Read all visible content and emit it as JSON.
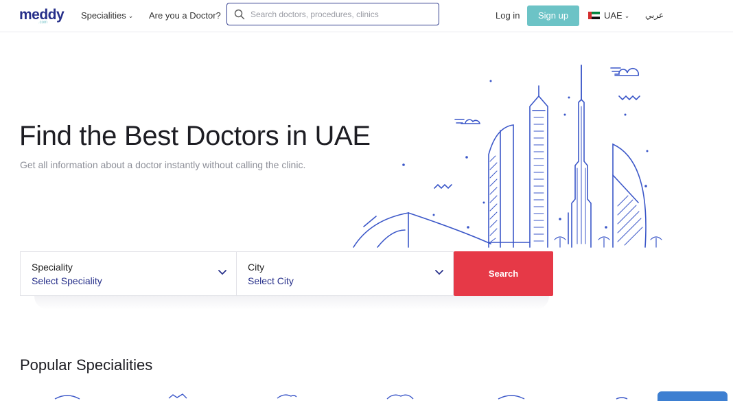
{
  "header": {
    "logo": "meddy",
    "logo_sub": ".com",
    "nav": {
      "specialities": "Specialities",
      "are_you_doctor": "Are you a Doctor?"
    },
    "search_placeholder": "Search doctors, procedures, clinics",
    "login": "Log in",
    "signup": "Sign up",
    "country": "UAE",
    "language": "عربي"
  },
  "hero": {
    "title": "Find the Best Doctors in UAE",
    "subtitle": "Get all information about a doctor instantly without calling the clinic."
  },
  "search_form": {
    "speciality_label": "Speciality",
    "speciality_value": "Select Speciality",
    "city_label": "City",
    "city_value": "Select City",
    "search_button": "Search"
  },
  "popular": {
    "title": "Popular Specialities"
  },
  "colors": {
    "brand_navy": "#27308a",
    "signup_teal": "#6cc3c6",
    "search_red": "#e63947",
    "illustration_blue": "#3a56c8"
  }
}
